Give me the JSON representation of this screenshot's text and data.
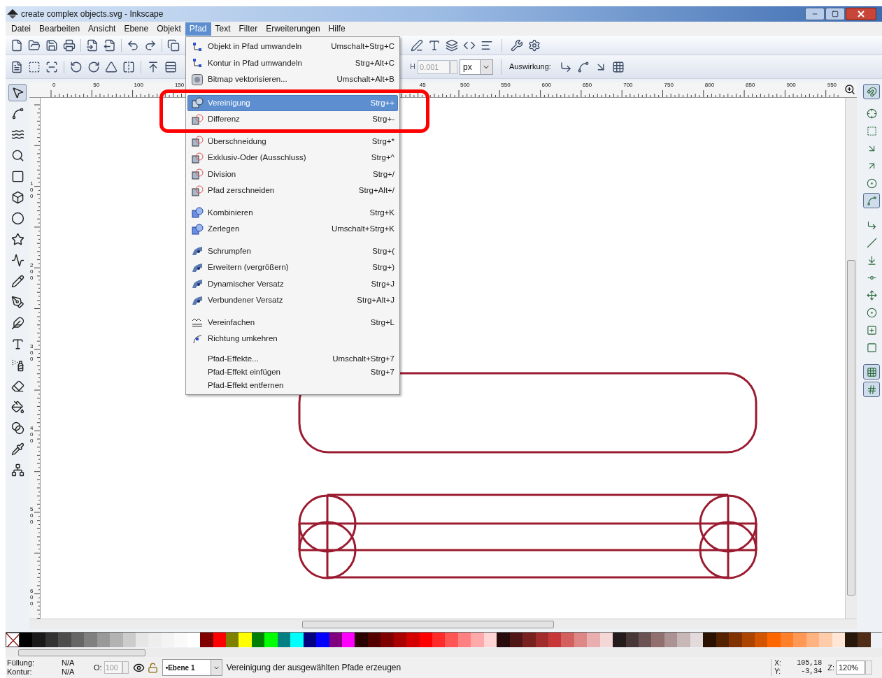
{
  "window": {
    "title": "create complex objects.svg - Inkscape"
  },
  "menu_bar": [
    {
      "label": "Datei",
      "selected": false
    },
    {
      "label": "Bearbeiten",
      "selected": false
    },
    {
      "label": "Ansicht",
      "selected": false
    },
    {
      "label": "Ebene",
      "selected": false
    },
    {
      "label": "Objekt",
      "selected": false
    },
    {
      "label": "Pfad",
      "selected": true
    },
    {
      "label": "Text",
      "selected": false
    },
    {
      "label": "Filter",
      "selected": false
    },
    {
      "label": "Erweiterungen",
      "selected": false
    },
    {
      "label": "Hilfe",
      "selected": false
    }
  ],
  "path_menu": [
    {
      "kind": "item",
      "label": "Objekt in Pfad umwandeln",
      "shortcut": "Umschalt+Strg+C",
      "selected": false
    },
    {
      "kind": "item",
      "label": "Kontur in Pfad umwandeln",
      "shortcut": "Strg+Alt+C",
      "selected": false
    },
    {
      "kind": "item",
      "label": "Bitmap vektorisieren...",
      "shortcut": "Umschalt+Alt+B",
      "selected": false
    },
    {
      "kind": "separator"
    },
    {
      "kind": "item",
      "label": "Vereinigung",
      "shortcut": "Strg++",
      "selected": true
    },
    {
      "kind": "item",
      "label": "Differenz",
      "shortcut": "Strg+-",
      "selected": false
    },
    {
      "kind": "item",
      "label": "Überschneidung",
      "shortcut": "Strg+*",
      "selected": false
    },
    {
      "kind": "item",
      "label": "Exklusiv-Oder (Ausschluss)",
      "shortcut": "Strg+^",
      "selected": false
    },
    {
      "kind": "item",
      "label": "Division",
      "shortcut": "Strg+/",
      "selected": false
    },
    {
      "kind": "item",
      "label": "Pfad zerschneiden",
      "shortcut": "Strg+Alt+/",
      "selected": false
    },
    {
      "kind": "separator"
    },
    {
      "kind": "item",
      "label": "Kombinieren",
      "shortcut": "Strg+K",
      "selected": false
    },
    {
      "kind": "item",
      "label": "Zerlegen",
      "shortcut": "Umschalt+Strg+K",
      "selected": false
    },
    {
      "kind": "separator"
    },
    {
      "kind": "item",
      "label": "Schrumpfen",
      "shortcut": "Strg+(",
      "selected": false
    },
    {
      "kind": "item",
      "label": "Erweitern (vergrößern)",
      "shortcut": "Strg+)",
      "selected": false
    },
    {
      "kind": "item",
      "label": "Dynamischer Versatz",
      "shortcut": "Strg+J",
      "selected": false
    },
    {
      "kind": "item",
      "label": "Verbundener Versatz",
      "shortcut": "Strg+Alt+J",
      "selected": false
    },
    {
      "kind": "separator"
    },
    {
      "kind": "item",
      "label": "Vereinfachen",
      "shortcut": "Strg+L",
      "selected": false
    },
    {
      "kind": "item",
      "label": "Richtung umkehren",
      "selected": false
    },
    {
      "kind": "separator"
    },
    {
      "kind": "text",
      "label": "Pfad-Effekte...",
      "shortcut": "Umschalt+Strg+7",
      "selected": false
    },
    {
      "kind": "text",
      "label": "Pfad-Effekt einfügen",
      "shortcut": "Strg+7",
      "selected": false
    },
    {
      "kind": "text",
      "label": "Pfad-Effekt entfernen",
      "selected": false
    }
  ],
  "toolbar2": {
    "h_label": "H",
    "h_value": "0.001",
    "unit": "px",
    "effect_label": "Auswirkung:"
  },
  "tools": [
    {
      "selected": true
    },
    {
      "selected": false
    },
    {
      "selected": false
    },
    {
      "selected": false
    },
    {
      "selected": false
    },
    {
      "selected": false
    },
    {
      "selected": false
    },
    {
      "selected": false
    },
    {
      "selected": false
    },
    {
      "selected": false
    },
    {
      "selected": false
    },
    {
      "selected": false
    },
    {
      "selected": false
    },
    {
      "selected": false
    },
    {
      "selected": false
    },
    {
      "selected": false
    },
    {
      "selected": false
    },
    {
      "selected": false
    },
    {
      "selected": false
    }
  ],
  "snap_buttons": [
    {
      "selected": true
    },
    {
      "selected": false
    },
    {
      "selected": false
    },
    {
      "selected": false
    },
    {
      "selected": false
    },
    {
      "selected": false
    },
    {
      "selected": true
    },
    {
      "selected": false
    },
    {
      "selected": false
    },
    {
      "selected": false
    },
    {
      "selected": false
    },
    {
      "selected": false
    },
    {
      "selected": false
    },
    {
      "selected": false
    },
    {
      "selected": false
    },
    {
      "selected": true
    },
    {
      "selected": true
    }
  ],
  "ruler": {
    "top_left_labels": [
      "0",
      "50",
      "100",
      "150"
    ],
    "top_right_labels": [
      "45",
      "500",
      "550",
      "600",
      "650",
      "700",
      "750",
      "800",
      "850",
      "900",
      "950"
    ],
    "left_labels": [
      "100",
      "200",
      "300",
      "400",
      "500",
      "600"
    ]
  },
  "palette": [
    {
      "color": "#000000"
    },
    {
      "color": "#1a1a1a"
    },
    {
      "color": "#333333"
    },
    {
      "color": "#4d4d4d"
    },
    {
      "color": "#666666"
    },
    {
      "color": "#808080"
    },
    {
      "color": "#999999"
    },
    {
      "color": "#b3b3b3"
    },
    {
      "color": "#cccccc"
    },
    {
      "color": "#e6e6e6"
    },
    {
      "color": "#eeeeee"
    },
    {
      "color": "#f4f4f4"
    },
    {
      "color": "#fafafa"
    },
    {
      "color": "#ffffff"
    },
    {
      "color": "#800000"
    },
    {
      "color": "#ff0000"
    },
    {
      "color": "#808000"
    },
    {
      "color": "#ffff00"
    },
    {
      "color": "#008000"
    },
    {
      "color": "#00ff00"
    },
    {
      "color": "#008080"
    },
    {
      "color": "#00ffff"
    },
    {
      "color": "#000080"
    },
    {
      "color": "#0000ff"
    },
    {
      "color": "#800080"
    },
    {
      "color": "#ff00ff"
    },
    {
      "color": "#2b0000"
    },
    {
      "color": "#550000"
    },
    {
      "color": "#800000"
    },
    {
      "color": "#aa0000"
    },
    {
      "color": "#d40000"
    },
    {
      "color": "#ff0000"
    },
    {
      "color": "#ff2a2a"
    },
    {
      "color": "#ff5555"
    },
    {
      "color": "#ff8080"
    },
    {
      "color": "#ffaaaa"
    },
    {
      "color": "#ffd5d5"
    },
    {
      "color": "#280b0b"
    },
    {
      "color": "#501616"
    },
    {
      "color": "#782121"
    },
    {
      "color": "#a02c2c"
    },
    {
      "color": "#c83737"
    },
    {
      "color": "#d35f5f"
    },
    {
      "color": "#de8787"
    },
    {
      "color": "#e9afaf"
    },
    {
      "color": "#f4d7d7"
    },
    {
      "color": "#241c1c"
    },
    {
      "color": "#483737"
    },
    {
      "color": "#6c5353"
    },
    {
      "color": "#916f6f"
    },
    {
      "color": "#ac9393"
    },
    {
      "color": "#c8b7b7"
    },
    {
      "color": "#e3dbdb"
    },
    {
      "color": "#2b1100"
    },
    {
      "color": "#552200"
    },
    {
      "color": "#803300"
    },
    {
      "color": "#aa4400"
    },
    {
      "color": "#d45500"
    },
    {
      "color": "#ff6600"
    },
    {
      "color": "#ff7f2a"
    },
    {
      "color": "#ff9955"
    },
    {
      "color": "#ffb380"
    },
    {
      "color": "#ffccaa"
    },
    {
      "color": "#ffe6d5"
    },
    {
      "color": "#28170b"
    },
    {
      "color": "#502d16"
    }
  ],
  "status_bar": {
    "fill_label": "Füllung:",
    "fill_value": "N/A",
    "stroke_label": "Kontur:",
    "stroke_value": "N/A",
    "opacity_label": "O:",
    "opacity_value": "100",
    "layer": "•Ebene 1",
    "message": "Vereinigung der ausgewählten Pfade erzeugen",
    "x_label": "X:",
    "x_value": "105,18",
    "y_label": "Y:",
    "y_value": "-3,34",
    "zoom_label": "Z:",
    "zoom_value": "120%"
  }
}
